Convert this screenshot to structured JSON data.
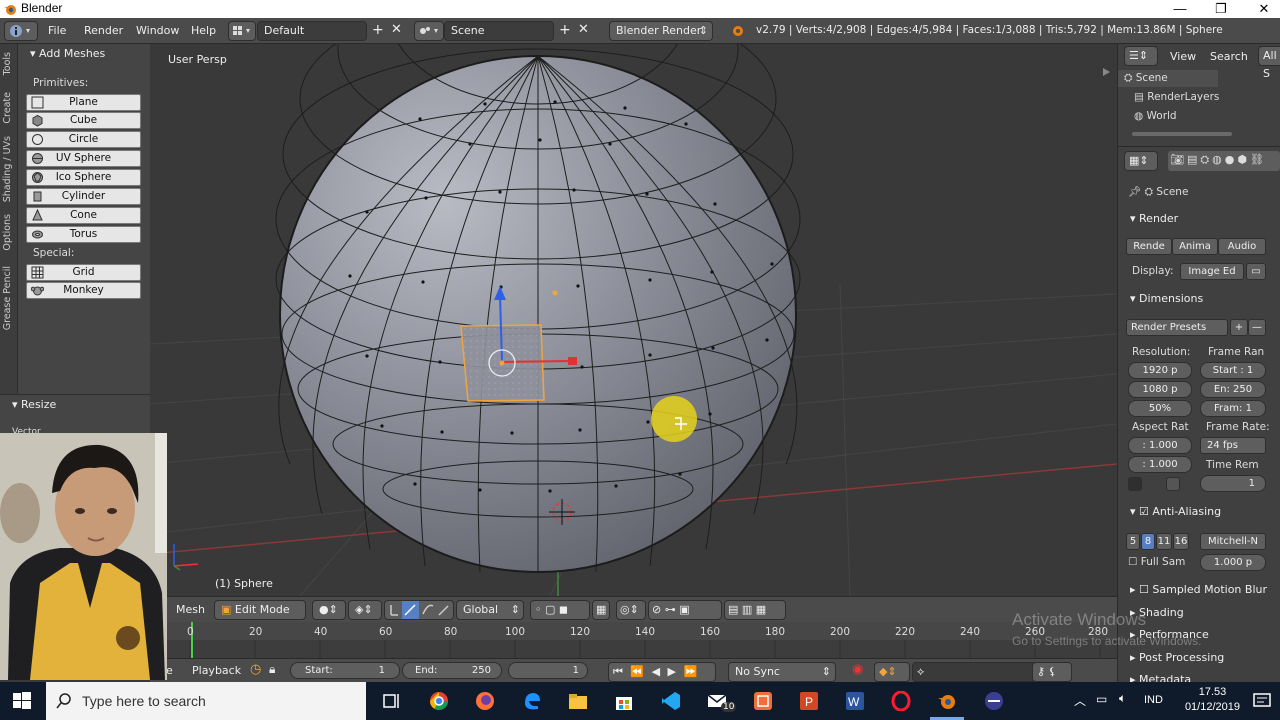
{
  "window": {
    "title": "Blender",
    "controls": {
      "minimize": "—",
      "maximize": "❐",
      "close": "✕"
    }
  },
  "info_header": {
    "menus": [
      "File",
      "Render",
      "Window",
      "Help"
    ],
    "layout": "Default",
    "scene": "Scene",
    "engine": "Blender Render",
    "stats": "v2.79 | Verts:4/2,908 | Edges:4/5,984 | Faces:1/3,088 | Tris:5,792 | Mem:13.86M | Sphere"
  },
  "tool_shelf": {
    "tabs": [
      "Tools",
      "Create",
      "Shading / UVs",
      "Options",
      "Grease Pencil"
    ],
    "panel_title": "Add Meshes",
    "primitives_label": "Primitives:",
    "primitives": [
      "Plane",
      "Cube",
      "Circle",
      "UV Sphere",
      "Ico Sphere",
      "Cylinder",
      "Cone",
      "Torus"
    ],
    "special_label": "Special:",
    "special": [
      "Grid",
      "Monkey"
    ],
    "operator_panel": "Resize",
    "operator_field": "Vector"
  },
  "viewport": {
    "view_label": "User Persp",
    "object_label": "(1) Sphere"
  },
  "viewport_header": {
    "menu": "Mesh",
    "mode": "Edit Mode",
    "orientation": "Global"
  },
  "timeline": {
    "ticks": [
      "0",
      "20",
      "40",
      "60",
      "80",
      "100",
      "120",
      "140",
      "160",
      "180",
      "200",
      "220",
      "240",
      "260",
      "280"
    ],
    "current_frame_marker": 0,
    "menu_cut": "e",
    "playback": "Playback",
    "start_label": "Start:",
    "start_value": "1",
    "end_label": "End:",
    "end_value": "250",
    "current": "1",
    "sync": "No Sync"
  },
  "outliner": {
    "menus": [
      "View",
      "Search",
      "All S"
    ],
    "items": [
      "Scene",
      "RenderLayers",
      "World"
    ]
  },
  "properties": {
    "context": "Scene",
    "render_panel": "Render",
    "render_buttons": [
      "Rende",
      "Anima",
      "Audio"
    ],
    "display_label": "Display:",
    "display_value": "Image Ed",
    "dimensions_panel": "Dimensions",
    "render_presets": "Render Presets",
    "resolution_label": "Resolution:",
    "res_x": "1920 p",
    "res_y": "1080 p",
    "res_pct": "50%",
    "frame_range_label": "Frame Ran",
    "frame_start": "Start : 1",
    "frame_end": "En: 250",
    "frame_step": "Fram: 1",
    "aspect_label": "Aspect Rat",
    "aspect_x": ": 1.000",
    "aspect_y": ": 1.000",
    "frame_rate_label": "Frame Rate:",
    "frame_rate": "24 fps",
    "time_remap_label": "Time Rem",
    "time_remap_value": "1",
    "aa_panel": "Anti-Aliasing",
    "aa_samples": [
      "5",
      "8",
      "11",
      "16"
    ],
    "aa_filter": "Mitchell-N",
    "full_sample": "Full Sam",
    "full_sample_value": "1.000 p",
    "collapsed_panels": [
      "Sampled Motion Blur",
      "Shading",
      "Performance",
      "Post Processing",
      "Metadata"
    ]
  },
  "watermark": {
    "line1": "Activate Windows",
    "line2": "Go to Settings to activate Windows."
  },
  "taskbar": {
    "search_placeholder": "Type here to search",
    "language": "IND",
    "time": "17.53",
    "date": "01/12/2019",
    "mail_badge": "10"
  },
  "colors": {
    "accent_blue": "#5680c2",
    "selection_orange": "#f2a53a",
    "mesh_face": "#8c8f9a",
    "viewport_bg": "#393939"
  }
}
